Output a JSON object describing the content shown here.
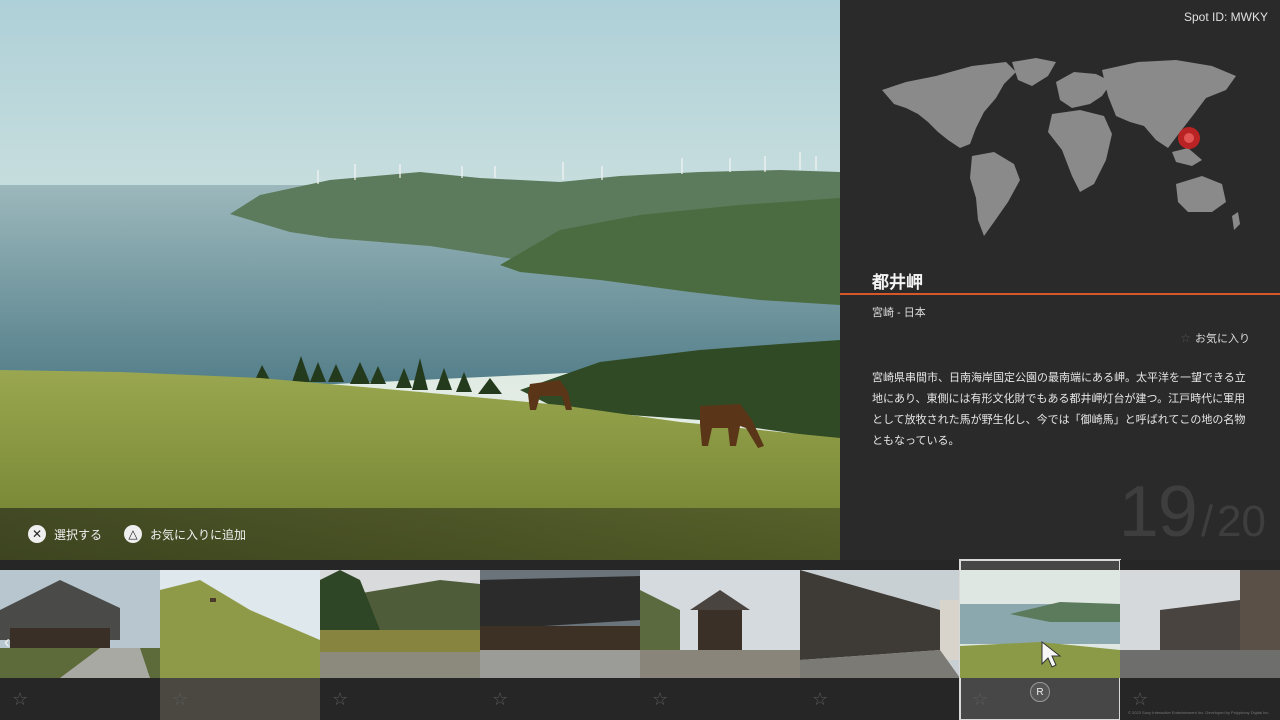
{
  "spot_id": "Spot ID: MWKY",
  "title": "都井岬",
  "region": "宮崎 - 日本",
  "favorite_label": "お気に入り",
  "description": "宮崎県串間市、日南海岸国定公園の最南端にある岬。太平洋を一望できる立地にあり、東側には有形文化財でもある都井岬灯台が建つ。江戸時代に軍用として放牧された馬が野生化し、今では「御崎馬」と呼ばれてこの地の名物ともなっている。",
  "counter": {
    "current": "19",
    "separator": "/",
    "total": "20"
  },
  "hints": [
    {
      "glyph": "✕",
      "label": "選択する"
    },
    {
      "glyph": "△",
      "label": "お気に入りに追加"
    }
  ],
  "thumbnails": [
    {
      "name": "thatched-house",
      "selected": false
    },
    {
      "name": "hill-horse",
      "selected": false
    },
    {
      "name": "pasture-fence",
      "selected": false
    },
    {
      "name": "old-storehouse",
      "selected": false
    },
    {
      "name": "castle-gate",
      "selected": false
    },
    {
      "name": "old-street",
      "selected": false
    },
    {
      "name": "cape-view",
      "selected": true
    },
    {
      "name": "town-street",
      "selected": false
    }
  ],
  "r_button": "R",
  "copyright": "© 2023 Sony Interactive Entertainment Inc. Developed by Polyphony Digital Inc.",
  "icons": {
    "star": "☆",
    "arrow_left": "‹"
  },
  "colors": {
    "accent": "#d8572a",
    "marker": "#c92222",
    "panel": "#2a2a2a"
  }
}
